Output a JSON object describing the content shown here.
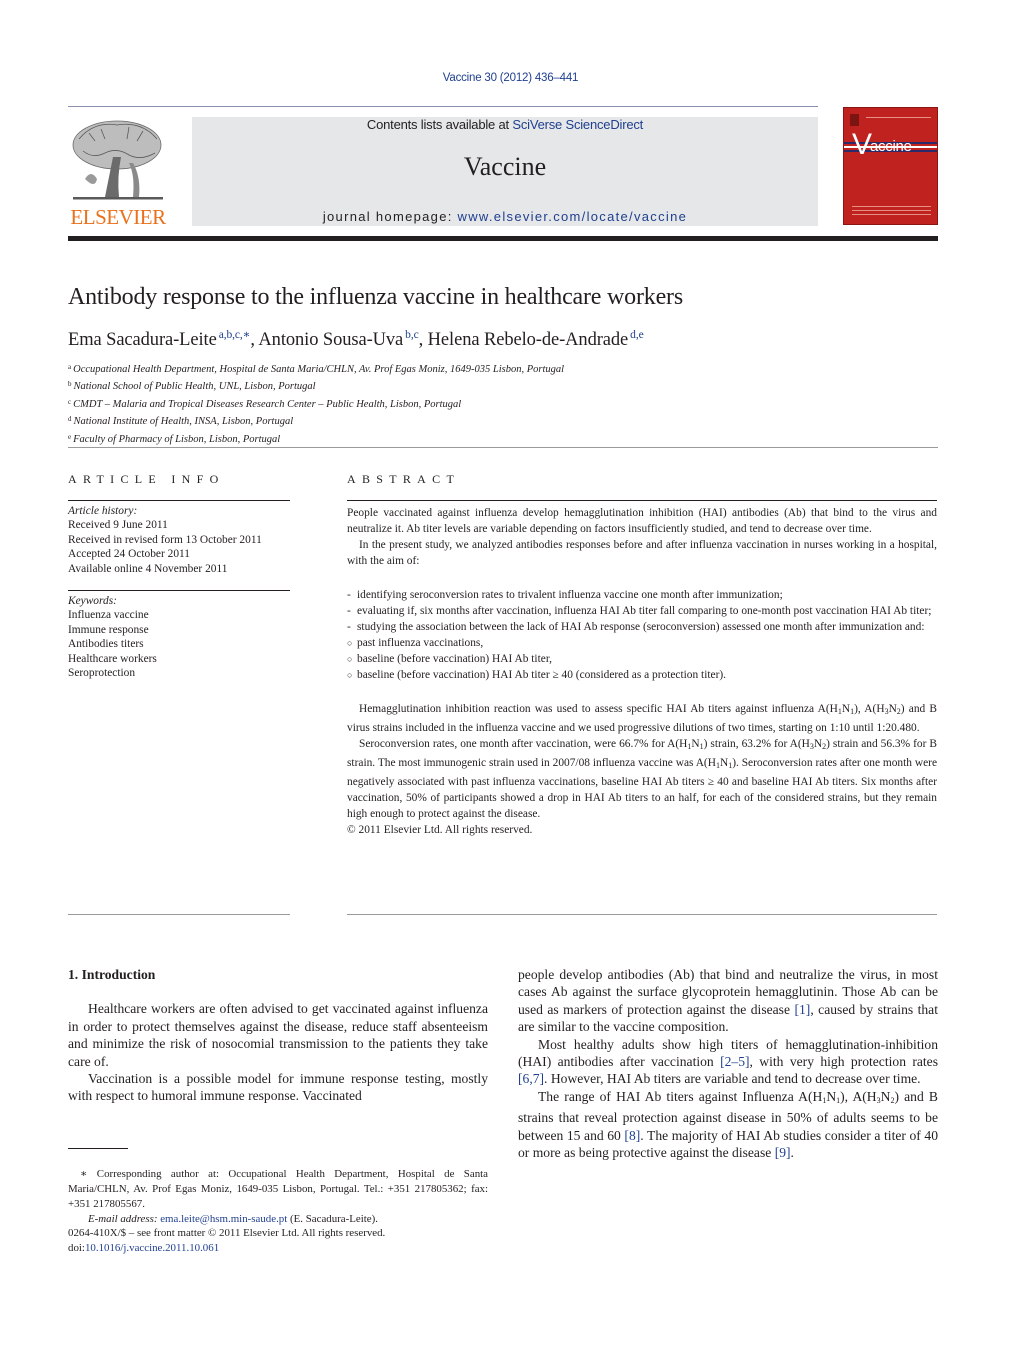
{
  "header": {
    "citation": "Vaccine 30 (2012) 436–441",
    "publisher_logo_text": "ELSEVIER",
    "contents_prefix": "Contents lists available at ",
    "contents_link": "SciVerse ScienceDirect",
    "journal_name": "Vaccine",
    "homepage_prefix": "journal homepage: ",
    "homepage_link": "www.elsevier.com/locate/vaccine",
    "cover_title": "accine",
    "cover_initial": "V",
    "colors": {
      "elsevier_orange": "#e9711c",
      "link_blue": "#1f3f8f",
      "cover_red": "#c0221f",
      "banner_grey": "#e6e7e8"
    }
  },
  "article": {
    "title": "Antibody response to the influenza vaccine in healthcare workers",
    "authors": [
      {
        "name": "Ema Sacadura-Leite",
        "marks": "a,b,c,∗",
        "sep": ", "
      },
      {
        "name": "Antonio Sousa-Uva",
        "marks": "b,c",
        "sep": ", "
      },
      {
        "name": "Helena Rebelo-de-Andrade",
        "marks": "d,e",
        "sep": ""
      }
    ],
    "affiliations": [
      {
        "mark": "a",
        "text": "Occupational Health Department, Hospital de Santa Maria/CHLN, Av. Prof Egas Moniz, 1649-035 Lisbon, Portugal"
      },
      {
        "mark": "b",
        "text": "National School of Public Health, UNL, Lisbon, Portugal"
      },
      {
        "mark": "c",
        "text": "CMDT – Malaria and Tropical Diseases Research Center – Public Health, Lisbon, Portugal"
      },
      {
        "mark": "d",
        "text": "National Institute of Health, INSA, Lisbon, Portugal"
      },
      {
        "mark": "e",
        "text": "Faculty of Pharmacy of Lisbon, Lisbon, Portugal"
      }
    ]
  },
  "article_info": {
    "heading": "ARTICLE INFO",
    "history_label": "Article history:",
    "history": [
      "Received 9 June 2011",
      "Received in revised form 13 October 2011",
      "Accepted 24 October 2011",
      "Available online 4 November 2011"
    ],
    "keywords_label": "Keywords:",
    "keywords": [
      "Influenza vaccine",
      "Immune response",
      "Antibodies titers",
      "Healthcare workers",
      "Seroprotection"
    ]
  },
  "abstract": {
    "heading": "ABSTRACT",
    "p1": "People vaccinated against influenza develop hemagglutination inhibition (HAI) antibodies (Ab) that bind to the virus and neutralize it. Ab titer levels are variable depending on factors insufficiently studied, and tend to decrease over time.",
    "p2": "In the present study, we analyzed antibodies responses before and after influenza vaccination in nurses working in a hospital, with the aim of:",
    "aims": [
      {
        "mark": "-",
        "text": "identifying seroconversion rates to trivalent influenza vaccine one month after immunization;"
      },
      {
        "mark": "-",
        "text": "evaluating if, six months after vaccination, influenza HAI Ab titer fall comparing to one-month post vaccination HAI Ab titer;"
      },
      {
        "mark": "-",
        "text": "studying the association between the lack of HAI Ab response (seroconversion) assessed one month after immunization and:"
      },
      {
        "mark": "○",
        "text": "past influenza vaccinations,"
      },
      {
        "mark": "○",
        "text": "baseline (before vaccination) HAI Ab titer,"
      },
      {
        "mark": "○",
        "text": "baseline (before vaccination) HAI Ab titer ≥ 40 (considered as a protection titer)."
      }
    ],
    "p3_a": "Hemagglutination inhibition reaction was used to assess specific HAI Ab titers against influenza A(H",
    "p3_b": "), A(H",
    "p3_c": ") and B virus strains included in the influenza vaccine and we used progressive dilutions of two times, starting on 1:10 until 1:20.480.",
    "p4_a": "Seroconversion rates, one month after vaccination, were 66.7% for A(H",
    "p4_b": ") strain, 63.2% for A(H",
    "p4_c": ") strain and 56.3% for B strain. The most immunogenic strain used in 2007/08 influenza vaccine was A(H",
    "p4_d": "). Seroconversion rates after one month were negatively associated with past influenza vaccinations, baseline HAI Ab titers ≥ 40 and baseline HAI Ab titers. Six months after vaccination, 50% of participants showed a drop in HAI Ab titers to an half, for each of the considered strains, but they remain high enough to protect against the disease.",
    "sub": {
      "one": "1",
      "two": "2",
      "three": "3",
      "N": "N"
    },
    "copyright": "© 2011 Elsevier Ltd. All rights reserved."
  },
  "body": {
    "section_heading": "1.  Introduction",
    "left_p1": "Healthcare workers are often advised to get vaccinated against influenza in order to protect themselves against the disease, reduce staff absenteeism and minimize the risk of nosocomial transmission to the patients they take care of.",
    "left_p2": "Vaccination is a possible model for immune response testing, mostly with respect to humoral immune response. Vaccinated",
    "right_p1_a": "people develop antibodies (Ab) that bind and neutralize the virus, in most cases Ab against the surface glycoprotein hemagglutinin. Those Ab can be used as markers of protection against the disease ",
    "right_p1_ref": "[1]",
    "right_p1_b": ", caused by strains that are similar to the vaccine composition.",
    "right_p2_a": "Most healthy adults show high titers of hemagglutination-inhibition (HAI) antibodies after vaccination ",
    "right_p2_ref1": "[2–5]",
    "right_p2_b": ", with very high protection rates ",
    "right_p2_ref2": "[6,7]",
    "right_p2_c": ". However, HAI Ab titers are variable and tend to decrease over time.",
    "right_p3_a": "The range of HAI Ab titers against Influenza A(H",
    "right_p3_b": "), A(H",
    "right_p3_c": ") and B strains that reveal protection against disease in 50% of adults seems to be between 15 and 60 ",
    "right_p3_ref1": "[8]",
    "right_p3_d": ". The majority of HAI Ab studies consider a titer of 40 or more as being protective against the disease ",
    "right_p3_ref2": "[9]",
    "right_p3_e": "."
  },
  "footnote": {
    "mark": "∗",
    "text": " Corresponding author at: Occupational Health Department, Hospital de Santa Maria/CHLN, Av. Prof Egas Moniz, 1649-035 Lisbon, Portugal. Tel.: +351 217805362; fax: +351 217805567.",
    "email_label": "E-mail address: ",
    "email": "ema.leite@hsm.min-saude.pt",
    "email_owner": " (E. Sacadura-Leite).",
    "front_matter": "0264-410X/$ – see front matter © 2011 Elsevier Ltd. All rights reserved.",
    "doi_label": "doi:",
    "doi": "10.1016/j.vaccine.2011.10.061"
  }
}
